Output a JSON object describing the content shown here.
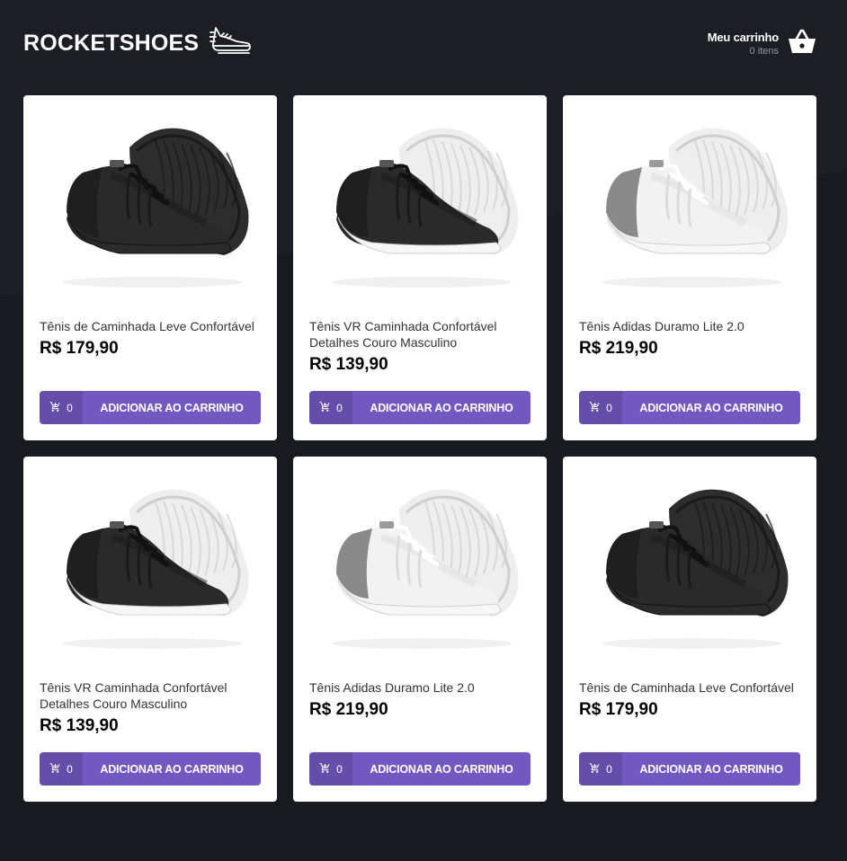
{
  "header": {
    "logo_text": "ROCKETSHOES",
    "cart_title": "Meu carrinho",
    "cart_count": "0 itens"
  },
  "colors": {
    "background": "#191920",
    "accent": "#7159c1",
    "card": "#ffffff"
  },
  "products": [
    {
      "title": "Tênis de Caminhada Leve Confortável",
      "price": "R$ 179,90",
      "amount": "0",
      "button_label": "ADICIONAR AO CARRINHO",
      "variant": "black"
    },
    {
      "title": "Tênis VR Caminhada Confortável Detalhes Couro Masculino",
      "price": "R$ 139,90",
      "amount": "0",
      "button_label": "ADICIONAR AO CARRINHO",
      "variant": "black-white"
    },
    {
      "title": "Tênis Adidas Duramo Lite 2.0",
      "price": "R$ 219,90",
      "amount": "0",
      "button_label": "ADICIONAR AO CARRINHO",
      "variant": "white-grey"
    },
    {
      "title": "Tênis VR Caminhada Confortável Detalhes Couro Masculino",
      "price": "R$ 139,90",
      "amount": "0",
      "button_label": "ADICIONAR AO CARRINHO",
      "variant": "black-white"
    },
    {
      "title": "Tênis Adidas Duramo Lite 2.0",
      "price": "R$ 219,90",
      "amount": "0",
      "button_label": "ADICIONAR AO CARRINHO",
      "variant": "white-grey"
    },
    {
      "title": "Tênis de Caminhada Leve Confortável",
      "price": "R$ 179,90",
      "amount": "0",
      "button_label": "ADICIONAR AO CARRINHO",
      "variant": "black"
    }
  ]
}
